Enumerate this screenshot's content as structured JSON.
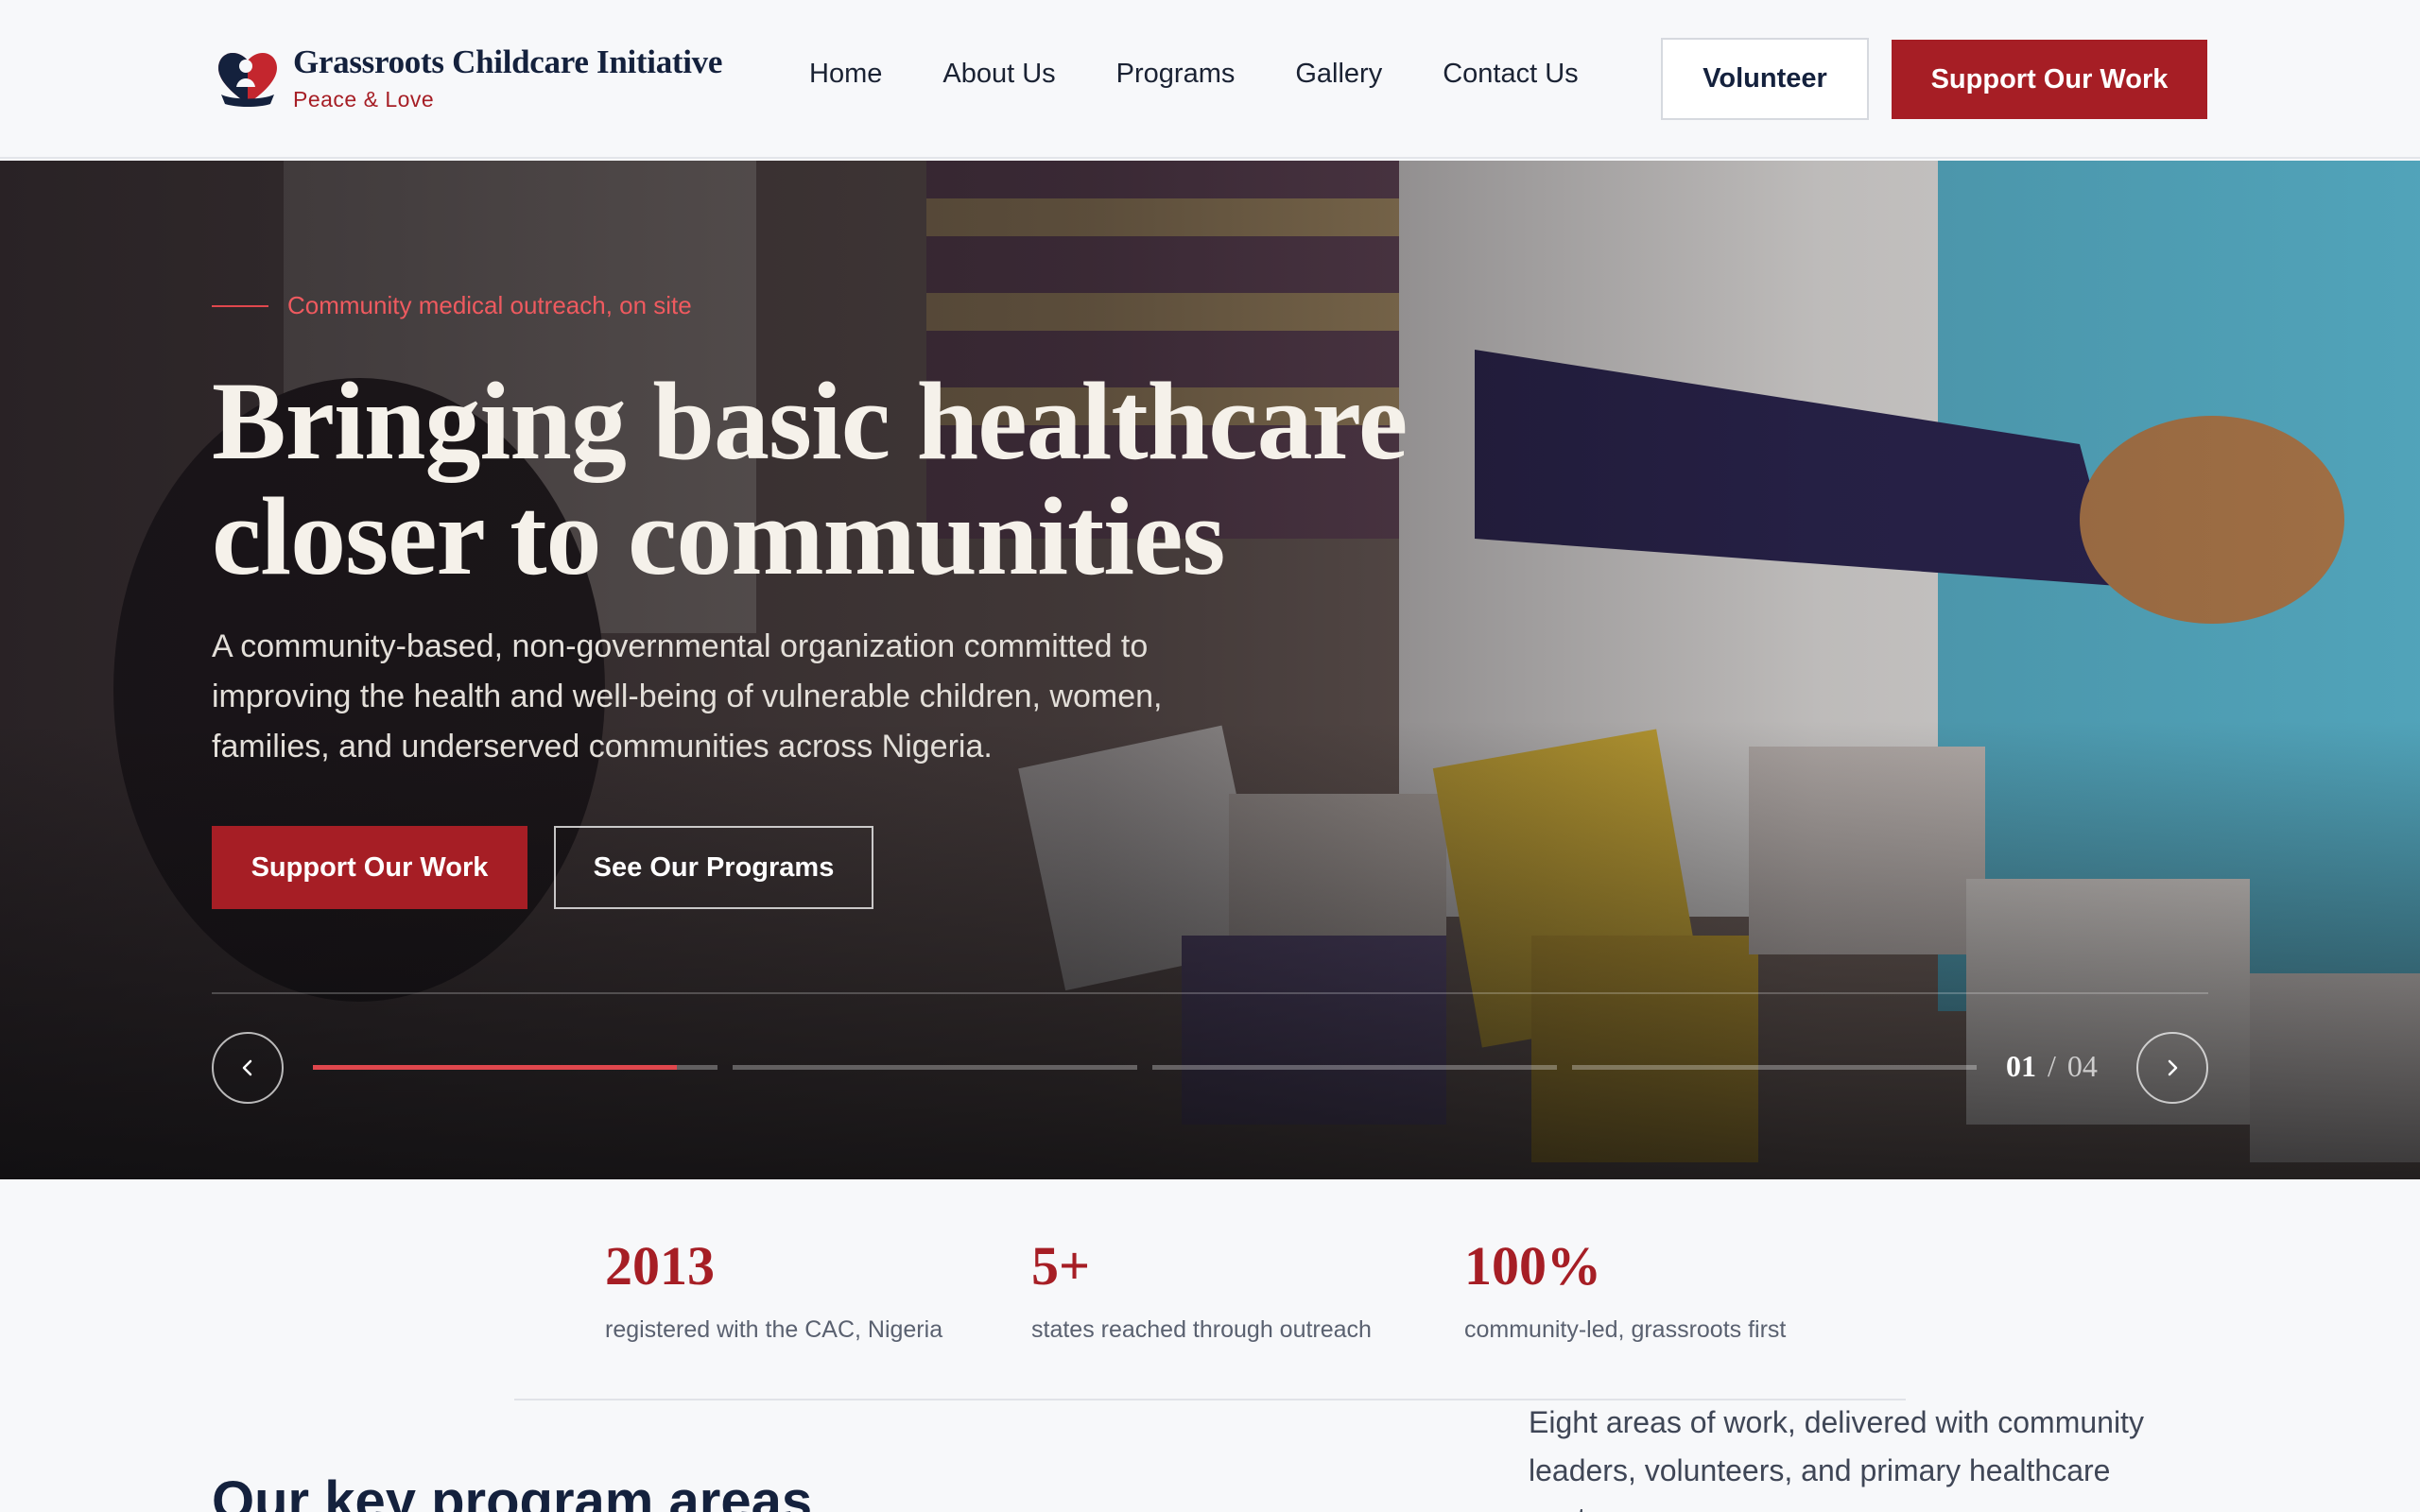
{
  "header": {
    "brand_name": "Grassroots Childcare Initiative",
    "brand_tagline": "Peace & Love",
    "nav": [
      "Home",
      "About Us",
      "Programs",
      "Gallery",
      "Contact Us"
    ],
    "volunteer_label": "Volunteer",
    "support_label": "Support Our Work"
  },
  "hero": {
    "eyebrow": "Community medical outreach, on site",
    "title": "Bringing basic healthcare closer to communities",
    "description": "A community-based, non-governmental organization committed to improving the health and well-being of vulnerable children, women, families, and underserved communities across Nigeria.",
    "primary_button": "Support Our Work",
    "secondary_button": "See Our Programs",
    "slider": {
      "current": "01",
      "separator": "/",
      "total": "04",
      "active_progress": 0.9
    }
  },
  "stats": [
    {
      "value": "2013",
      "label": "registered with the CAC, Nigeria"
    },
    {
      "value": "5+",
      "label": "states reached through outreach"
    },
    {
      "value": "100%",
      "label": "community-led, grassroots first"
    }
  ],
  "programs": {
    "heading": "Our key program areas",
    "description": "Eight areas of work, delivered with community leaders, volunteers, and primary healthcare centres."
  },
  "colors": {
    "brand_red": "#a61e25",
    "navy": "#14213d",
    "accent_red": "#e0474d"
  }
}
